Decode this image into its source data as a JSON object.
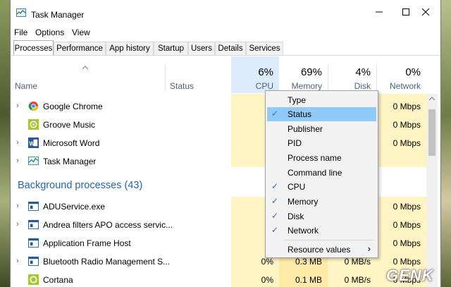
{
  "window": {
    "title": "Task Manager"
  },
  "menu": [
    "File",
    "Options",
    "View"
  ],
  "tabs": [
    "Processes",
    "Performance",
    "App history",
    "Startup",
    "Users",
    "Details",
    "Services"
  ],
  "columns": {
    "name": "Name",
    "status": "Status",
    "cpu": {
      "pct": "6%",
      "label": "CPU"
    },
    "memory": {
      "pct": "69%",
      "label": "Memory"
    },
    "disk": {
      "pct": "4%",
      "label": "Disk"
    },
    "network": {
      "pct": "0%",
      "label": "Network"
    }
  },
  "apps": [
    {
      "name": "Google Chrome",
      "icon": "chrome-icon",
      "network": "0 Mbps",
      "expand": true
    },
    {
      "name": "Groove Music",
      "icon": "groove-music-icon",
      "network": "0 Mbps",
      "expand": false
    },
    {
      "name": "Microsoft Word",
      "icon": "word-icon",
      "network": "0 Mbps",
      "expand": true
    },
    {
      "name": "Task Manager",
      "icon": "task-manager-icon",
      "network": "0 Mbps",
      "expand": true
    }
  ],
  "background_group": "Background processes (43)",
  "bg": [
    {
      "name": "ADUService.exe",
      "icon": "app-window-icon",
      "cpu": "",
      "memory": "",
      "disk": "",
      "network": "0 Mbps",
      "expand": true
    },
    {
      "name": "Andrea filters APO access servic...",
      "icon": "app-window-icon",
      "cpu": "",
      "memory": "",
      "disk": "",
      "network": "0 Mbps",
      "expand": true
    },
    {
      "name": "Application Frame Host",
      "icon": "app-window-icon",
      "cpu": "",
      "memory": "",
      "disk": "",
      "network": "0 Mbps",
      "expand": false
    },
    {
      "name": "Bluetooth Radio Management S...",
      "icon": "app-window-icon",
      "cpu": "0%",
      "memory": "0.3 MB",
      "disk": "0 MB/s",
      "network": "0 Mbps",
      "expand": true
    },
    {
      "name": "Cortana",
      "icon": "cortana-icon",
      "cpu": "0%",
      "memory": "0.1 MB",
      "disk": "0 MB/s",
      "network": "0 Mbps",
      "expand": false
    }
  ],
  "context_menu": [
    {
      "label": "Type",
      "checked": false
    },
    {
      "label": "Status",
      "checked": true,
      "highlight": true
    },
    {
      "label": "Publisher",
      "checked": false
    },
    {
      "label": "PID",
      "checked": false
    },
    {
      "label": "Process name",
      "checked": false
    },
    {
      "label": "Command line",
      "checked": false
    },
    {
      "label": "CPU",
      "checked": true
    },
    {
      "label": "Memory",
      "checked": true
    },
    {
      "label": "Disk",
      "checked": true
    },
    {
      "label": "Network",
      "checked": true
    }
  ],
  "resource_values": "Resource values",
  "check_glyph": "✓",
  "submenu_glyph": "›",
  "watermark": "GENK",
  "colors": {
    "heat_light": "#fff4c4",
    "heat_header": "#dcecfc",
    "highlight": "#91c9f7",
    "group_text": "#2464b4"
  }
}
